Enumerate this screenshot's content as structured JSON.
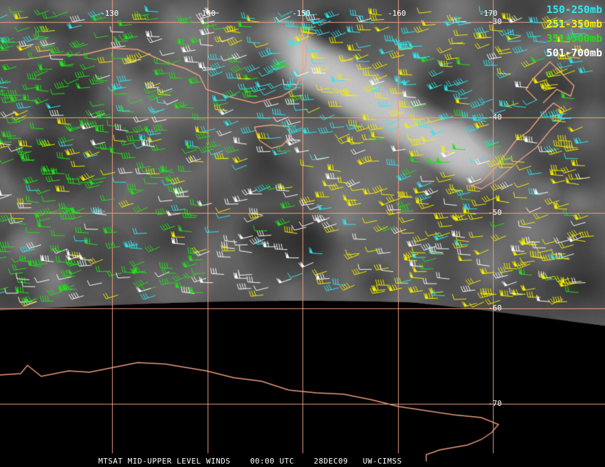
{
  "colors": {
    "graticule": "#f0a080",
    "coast": "#f0a080",
    "night": "#000000",
    "cloud_dark": "#3a3a3a",
    "cloud_light": "#bdbdbd"
  },
  "longitude_labels": [
    "-130",
    "-140",
    "-150",
    "-160",
    "-170"
  ],
  "latitude_labels": [
    "-30",
    "-40",
    "-50",
    "-60",
    "-70"
  ],
  "legend": [
    {
      "label": "150-250mb",
      "color": "#2ee8f0"
    },
    {
      "label": "251-350mb",
      "color": "#f5f000"
    },
    {
      "label": "351-500mb",
      "color": "#22e01a"
    },
    {
      "label": "501-700mb",
      "color": "#ffffff"
    }
  ],
  "footer": {
    "product": "MTSAT MID-UPPER LEVEL WINDS",
    "time": "00:00 UTC",
    "date": "28DEC09",
    "source": "UW-CIMSS"
  }
}
